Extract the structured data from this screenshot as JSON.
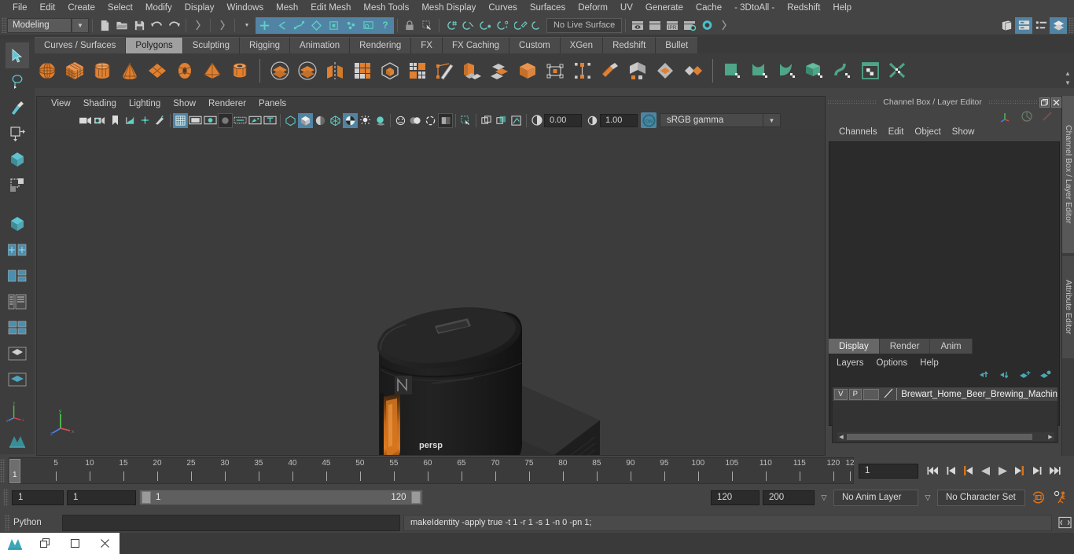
{
  "menubar": {
    "items": [
      "File",
      "Edit",
      "Create",
      "Select",
      "Modify",
      "Display",
      "Windows",
      "Mesh",
      "Edit Mesh",
      "Mesh Tools",
      "Mesh Display",
      "Curves",
      "Surfaces",
      "Deform",
      "UV",
      "Generate",
      "Cache",
      "- 3DtoAll -",
      "Redshift",
      "Help"
    ]
  },
  "statusline": {
    "menuset": "Modeling",
    "live_surface": "No Live Surface",
    "icons": [
      "new-scene-icon",
      "open-scene-icon",
      "save-scene-icon",
      "undo-icon",
      "redo-icon",
      "select-by-hierarchy-icon",
      "select-by-object-icon",
      "select-by-component-icon",
      "hilite-icon",
      "select-handle-icon",
      "select-joint-icon",
      "select-curve-icon",
      "select-surface-icon",
      "select-deformation-icon",
      "select-dynamic-icon",
      "select-rendering-icon",
      "select-misc-icon",
      "lock-icon",
      "marquee-select-icon",
      "snap-grid-icon",
      "snap-curve-icon",
      "snap-point-icon",
      "snap-projected-icon",
      "snap-view-plane-icon",
      "snap-live-icon",
      "render-current-frame-icon",
      "render-sequence-icon",
      "ipr-render-icon",
      "render-settings-icon",
      "hypershade-icon",
      "show-hide-editor-icon",
      "attribute-editor-icon",
      "tool-settings-icon",
      "channel-box-icon"
    ]
  },
  "shelf": {
    "tabs": [
      "Curves / Surfaces",
      "Polygons",
      "Sculpting",
      "Rigging",
      "Animation",
      "Rendering",
      "FX",
      "FX Caching",
      "Custom",
      "XGen",
      "Redshift",
      "Bullet"
    ],
    "active_tab": "Polygons",
    "icons": [
      "poly-sphere-icon",
      "poly-cube-icon",
      "poly-cylinder-icon",
      "poly-cone-icon",
      "poly-plane-icon",
      "poly-torus-icon",
      "poly-pyramid-icon",
      "poly-pipe-icon",
      "boolean-union-icon",
      "boolean-difference-icon",
      "mirror-geometry-icon",
      "combine-icon",
      "smooth-icon",
      "extract-icon",
      "multi-cut-icon",
      "extrude-icon",
      "bevel-icon",
      "bridge-icon",
      "append-polygon-icon",
      "target-weld-icon",
      "sculpt-tool-icon",
      "crease-tool-icon",
      "uv-editor-icon",
      "transfer-attributes-icon",
      "green-plane-icon",
      "green-curve-icon",
      "green-patch-icon",
      "green-cube-icon",
      "green-wave-icon",
      "green-window-icon",
      "green-cross-icon"
    ]
  },
  "toolbox": {
    "tools": [
      "select-tool-icon",
      "lasso-select-tool-icon",
      "paint-select-tool-icon",
      "move-tool-icon",
      "rotate-tool-icon",
      "scale-tool-icon",
      "last-tool-icon",
      "rgb-component-icon",
      "layout-split-icon",
      "layout-two-pane-icon",
      "layout-three-pane-icon",
      "layout-four-pane-icon",
      "layout-single-icon",
      "layout-outliner-icon",
      "layout-persp-icon"
    ]
  },
  "viewport": {
    "menus": [
      "View",
      "Shading",
      "Lighting",
      "Show",
      "Renderer",
      "Panels"
    ],
    "camera_label": "persp",
    "exposure": "0.00",
    "gamma": "1.00",
    "color_profile": "sRGB gamma",
    "toolbar_icons": [
      "select-camera-icon",
      "camera-attributes-icon",
      "bookmark-icon",
      "image-plane-icon",
      "resolution-gate-icon",
      "film-gate-icon",
      "grid-icon",
      "film-gate-2-icon",
      "resolution-gate-2-icon",
      "gate-mask-icon",
      "exposure-icon",
      "xray-icon",
      "texture-icon",
      "wireframe-icon",
      "smooth-shade-icon",
      "shaded-wireframe-icon",
      "flat-shade-icon",
      "textured-icon",
      "lighting-icon",
      "shadows-icon",
      "screen-space-ao-icon",
      "motion-blur-icon",
      "multisample-icon",
      "depth-of-field-icon",
      "isolate-select-icon",
      "xray-joints-icon",
      "xray-active-icon",
      "view-transform-icon",
      "exposure-control-icon",
      "gamma-control-icon",
      "color-management-icon"
    ]
  },
  "channelbox": {
    "panel_title": "Channel Box / Layer Editor",
    "menus": [
      "Channels",
      "Edit",
      "Object",
      "Show"
    ],
    "window_buttons": [
      "restore-icon",
      "close-icon"
    ],
    "corner_icons": [
      "axis-gizmo-icon",
      "circle-icon",
      "stroke-icon"
    ]
  },
  "layereditor": {
    "tabs": [
      "Display",
      "Render",
      "Anim"
    ],
    "active_tab": "Display",
    "menus": [
      "Layers",
      "Options",
      "Help"
    ],
    "buttons": [
      "move-layer-up-icon",
      "move-layer-down-icon",
      "new-layer-icon",
      "new-layer-from-selected-icon"
    ],
    "layers": [
      {
        "visibility": "V",
        "playback": "P",
        "color_swatch": "",
        "name": "Brewart_Home_Beer_Brewing_Machin"
      }
    ]
  },
  "dockbar": {
    "tabs": [
      "Channel Box / Layer Editor",
      "Attribute Editor"
    ]
  },
  "timeslider": {
    "ticks": [
      5,
      10,
      15,
      20,
      25,
      30,
      35,
      40,
      45,
      50,
      55,
      60,
      65,
      70,
      75,
      80,
      85,
      90,
      95,
      100,
      105,
      110,
      115,
      120
    ],
    "current_frame": "1",
    "current_frame_field": "1",
    "end_marker": "12",
    "playback_buttons": [
      "go-to-start-icon",
      "step-back-keyframe-icon",
      "step-back-frame-icon",
      "play-backwards-icon",
      "play-forwards-icon",
      "step-forward-frame-icon",
      "step-forward-keyframe-icon",
      "go-to-end-icon"
    ]
  },
  "rangeslider": {
    "anim_start": "1",
    "playback_start": "1",
    "range_start_label": "1",
    "range_end_label": "120",
    "playback_end": "120",
    "anim_end": "200",
    "anim_layer": "No Anim Layer",
    "character_set": "No Character Set",
    "right_icons": [
      "auto-keyframe-icon",
      "animation-preferences-icon"
    ]
  },
  "commandline": {
    "language_label": "Python",
    "input_value": "",
    "output_text": "makeIdentity -apply true -t 1 -r 1 -s 1 -n 0 -pn 1;",
    "script-editor-icon": "script-editor-icon"
  },
  "taskbar": {
    "window_buttons": [
      "maya-app-icon",
      "restore-window-icon",
      "minimize-window-icon",
      "close-window-icon"
    ]
  },
  "colors": {
    "accent_blue": "#5184a4",
    "shelf_orange": "#e08030",
    "shelf_green": "#4ea588",
    "panel_bg": "#444444",
    "viewport_bg": "#3c3c3c",
    "field_bg": "#2b2b2b"
  }
}
